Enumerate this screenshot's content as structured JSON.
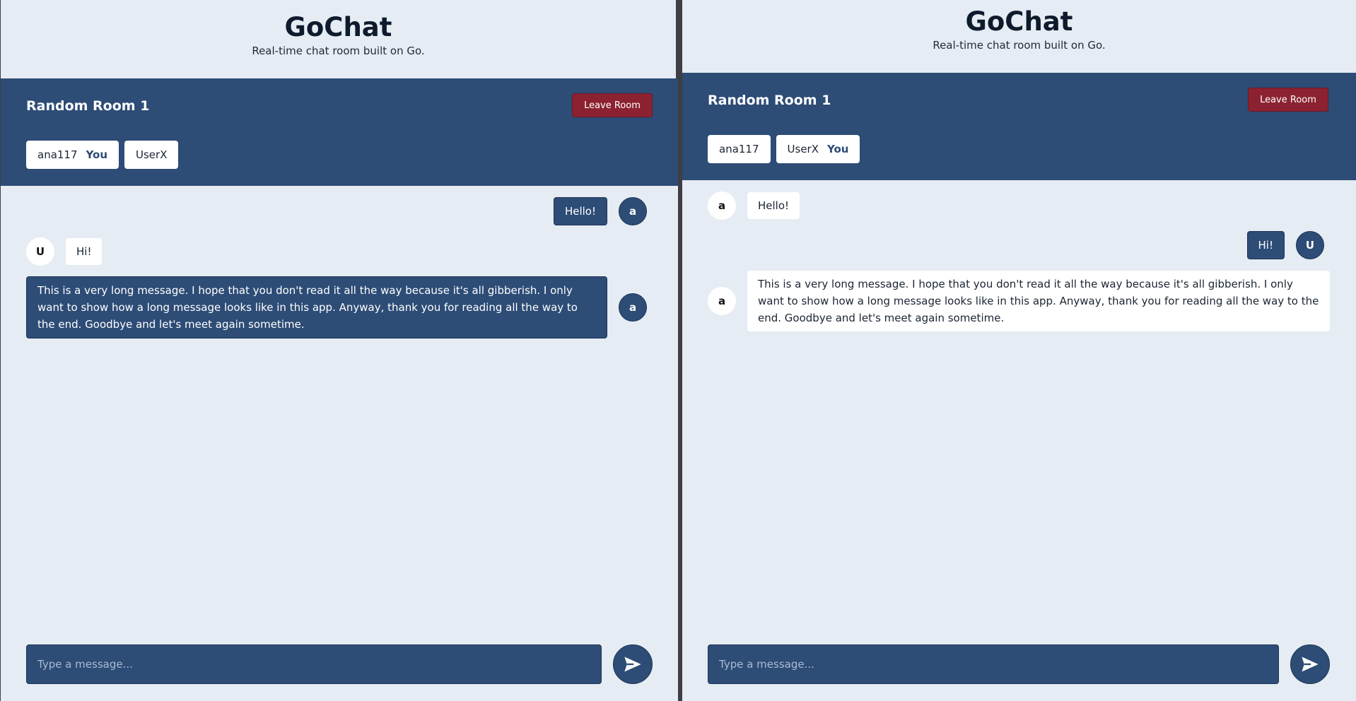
{
  "app": {
    "title": "GoChat",
    "subtitle": "Real-time chat room built on Go."
  },
  "room": {
    "name": "Random Room 1",
    "leave_label": "Leave Room"
  },
  "you_label": "You",
  "composer": {
    "placeholder": "Type a message..."
  },
  "left": {
    "users": [
      "ana117",
      "UserX"
    ],
    "messages": [
      {
        "text": "Hello!",
        "initial": "a",
        "mine": true
      },
      {
        "text": "Hi!",
        "initial": "U",
        "mine": false
      },
      {
        "text": "This is a very long message. I hope that you don't read it all the way because it's all gibberish. I only want to show how a long message looks like in this app. Anyway, thank you for reading all the way to the end. Goodbye and let's meet again sometime.",
        "initial": "a",
        "mine": true
      }
    ]
  },
  "right": {
    "users": [
      "ana117",
      "UserX"
    ],
    "messages": [
      {
        "text": "Hello!",
        "initial": "a",
        "mine": false
      },
      {
        "text": "Hi!",
        "initial": "U",
        "mine": true
      },
      {
        "text": "This is a very long message. I hope that you don't read it all the way because it's all gibberish. I only want to show how a long message looks like in this app. Anyway, thank you for reading all the way to the end. Goodbye and let's meet again sometime.",
        "initial": "a",
        "mine": false
      }
    ]
  },
  "icons": {
    "send": "send-icon"
  },
  "colors": {
    "primary": "#2d4c76",
    "danger": "#8c2231",
    "background": "#e6ecf3"
  }
}
